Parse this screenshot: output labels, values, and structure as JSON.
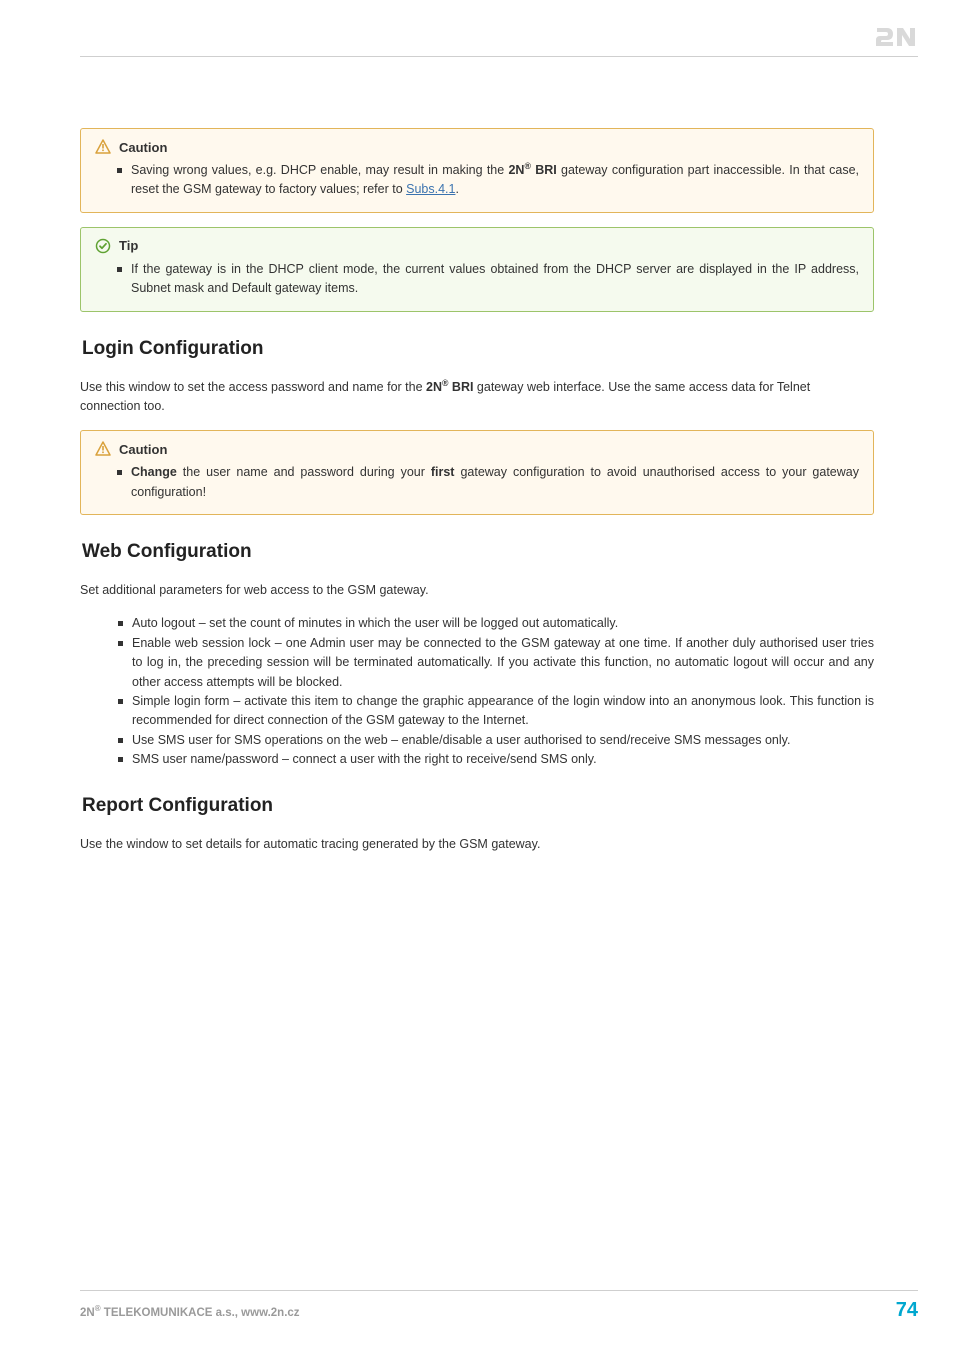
{
  "logo_alt": "2N",
  "callouts": {
    "caution1": {
      "title": "Caution",
      "item_pre": "Saving wrong values, e.g. DHCP enable, may result in making the ",
      "item_bold1": "2N",
      "item_bold2": " BRI",
      "item_mid": " gateway configuration part inaccessible. In that case, reset the GSM gateway to factory values; refer to ",
      "link_text": "Subs.4.1",
      "item_end": "."
    },
    "tip1": {
      "title": "Tip",
      "item": "If the gateway is in the DHCP client mode, the current values obtained from the DHCP server are displayed in the IP address, Subnet mask and Default gateway items."
    },
    "caution2": {
      "title": "Caution",
      "bold1": "Change",
      "mid": " the user name and password during your ",
      "bold2": "first",
      "end": " gateway configuration to avoid unauthorised access to your gateway configuration!"
    }
  },
  "sections": {
    "login": {
      "heading": "Login Configuration",
      "para_pre": "Use this window to set the access password and name for the ",
      "para_bold1": "2N",
      "para_bold2": " BRI",
      "para_end": " gateway web interface. Use the same access data for Telnet connection too."
    },
    "web": {
      "heading": "Web Configuration",
      "para": "Set additional parameters for web access to the GSM gateway.",
      "items": [
        "Auto logout – set the count of minutes in which the user will be logged out automatically.",
        "Enable web session lock – one Admin user may be connected to the GSM gateway at one time. If another duly authorised user tries to log in, the preceding session will be terminated automatically. If you activate this function, no automatic logout will occur and any other access attempts will be blocked.",
        "Simple login form – activate this item to change the graphic appearance of the login window into an anonymous look. This function is recommended for direct connection of the GSM gateway to the Internet.",
        "Use SMS user for SMS operations on the web – enable/disable a user authorised to send/receive SMS messages only.",
        "SMS user name/password – connect a user with the right to receive/send SMS only."
      ]
    },
    "report": {
      "heading": "Report Configuration",
      "para": "Use the window to set details for automatic tracing generated by the GSM gateway."
    }
  },
  "footer": {
    "company_pre": "2N",
    "company_post": " TELEKOMUNIKACE a.s., www.2n.cz",
    "page": "74"
  }
}
